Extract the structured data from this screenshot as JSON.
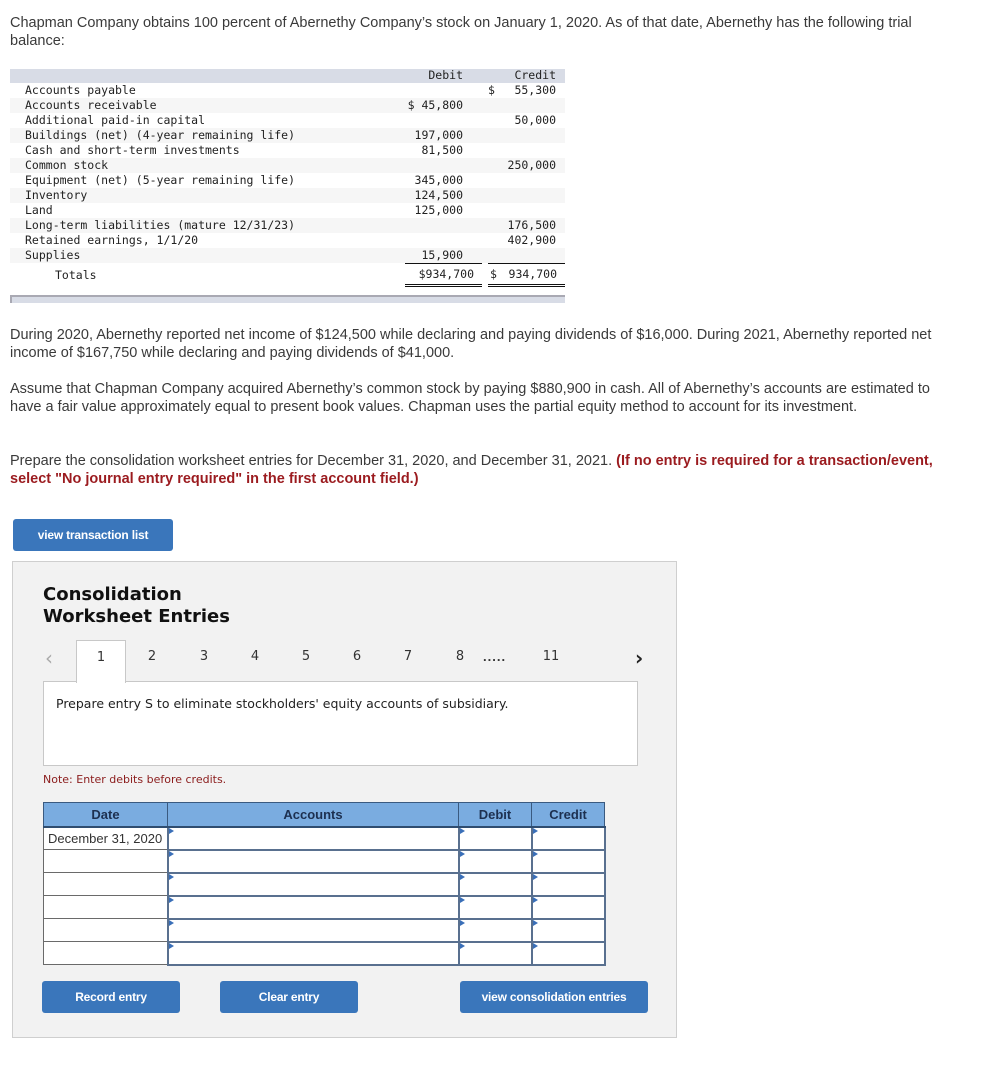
{
  "intro": "Chapman Company obtains 100 percent of Abernethy Company’s stock on January 1, 2020. As of that date, Abernethy has the following trial balance:",
  "trial_balance": {
    "headers": {
      "debit": "Debit",
      "credit": "Credit"
    },
    "rows": [
      {
        "label": "Accounts payable",
        "debit": "",
        "credit": "55,300",
        "credit_prefix": "$"
      },
      {
        "label": "Accounts receivable",
        "debit": "$ 45,800",
        "credit": ""
      },
      {
        "label": "Additional paid-in capital",
        "debit": "",
        "credit": "50,000"
      },
      {
        "label": "Buildings (net) (4-year remaining life)",
        "debit": "197,000",
        "credit": ""
      },
      {
        "label": "Cash and short-term investments",
        "debit": "81,500",
        "credit": ""
      },
      {
        "label": "Common stock",
        "debit": "",
        "credit": "250,000"
      },
      {
        "label": "Equipment (net) (5-year remaining life)",
        "debit": "345,000",
        "credit": ""
      },
      {
        "label": "Inventory",
        "debit": "124,500",
        "credit": ""
      },
      {
        "label": "Land",
        "debit": "125,000",
        "credit": ""
      },
      {
        "label": "Long-term liabilities (mature 12/31/23)",
        "debit": "",
        "credit": "176,500"
      },
      {
        "label": "Retained earnings, 1/1/20",
        "debit": "",
        "credit": "402,900"
      },
      {
        "label": "Supplies",
        "debit": "15,900",
        "credit": ""
      }
    ],
    "totals": {
      "label": "Totals",
      "debit": "$934,700",
      "credit_prefix": "$",
      "credit": "934,700"
    }
  },
  "para_income": "During 2020, Abernethy reported net income of $124,500 while declaring and paying dividends of $16,000. During 2021, Abernethy reported net income of $167,750 while declaring and paying dividends of $41,000.",
  "para_assume": "Assume that Chapman Company acquired Abernethy’s common stock by paying $880,900 in cash. All of Abernethy’s accounts are estimated to have a fair value approximately equal to present book values. Chapman uses the partial equity method to account for its investment.",
  "para_prepare": "Prepare the consolidation worksheet entries for December 31, 2020, and December 31, 2021. ",
  "para_prepare_note": "(If no entry is required for a transaction/event, select \"No journal entry required\" in the first account field.)",
  "view_transaction_list": "view transaction list",
  "worksheet": {
    "title_line1": "Consolidation",
    "title_line2": "Worksheet Entries",
    "pager": {
      "prev_icon": "‹",
      "next_icon": "›",
      "pages": [
        "1",
        "2",
        "3",
        "4",
        "5",
        "6",
        "7",
        "8"
      ],
      "ellipsis": ".....",
      "last": "11",
      "active": "1"
    },
    "instruction": "Prepare entry S to eliminate stockholders' equity accounts of subsidiary.",
    "note": "Note: Enter debits before credits.",
    "table": {
      "headers": {
        "date": "Date",
        "accounts": "Accounts",
        "debit": "Debit",
        "credit": "Credit"
      },
      "rows": [
        {
          "date": "December 31, 2020",
          "account": "",
          "debit": "",
          "credit": ""
        },
        {
          "date": "",
          "account": "",
          "debit": "",
          "credit": ""
        },
        {
          "date": "",
          "account": "",
          "debit": "",
          "credit": ""
        },
        {
          "date": "",
          "account": "",
          "debit": "",
          "credit": ""
        },
        {
          "date": "",
          "account": "",
          "debit": "",
          "credit": ""
        },
        {
          "date": "",
          "account": "",
          "debit": "",
          "credit": ""
        }
      ]
    },
    "buttons": {
      "record": "Record entry",
      "clear": "Clear entry",
      "view": "view consolidation entries"
    }
  }
}
